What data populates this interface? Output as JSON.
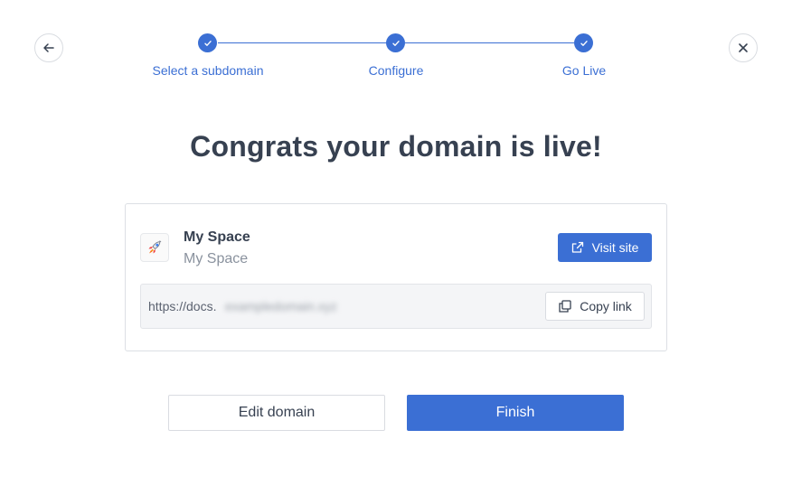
{
  "nav": {
    "back_icon": "arrow-left-icon",
    "close_icon": "close-icon"
  },
  "stepper": {
    "steps": [
      {
        "label": "Select a subdomain",
        "completed": true
      },
      {
        "label": "Configure",
        "completed": true
      },
      {
        "label": "Go Live",
        "completed": true
      }
    ],
    "accent_color": "#3b6fd4"
  },
  "headline": "Congrats your domain is live!",
  "site_card": {
    "icon": "rocket-icon",
    "title": "My Space",
    "subtitle": "My Space",
    "visit_label": "Visit site",
    "url_prefix": "https://docs.",
    "url_redacted": "exampledomain.xyz",
    "copy_label": "Copy link"
  },
  "actions": {
    "edit_label": "Edit domain",
    "finish_label": "Finish"
  },
  "colors": {
    "primary": "#3b6fd4",
    "text": "#374151",
    "muted": "#8a929e"
  }
}
